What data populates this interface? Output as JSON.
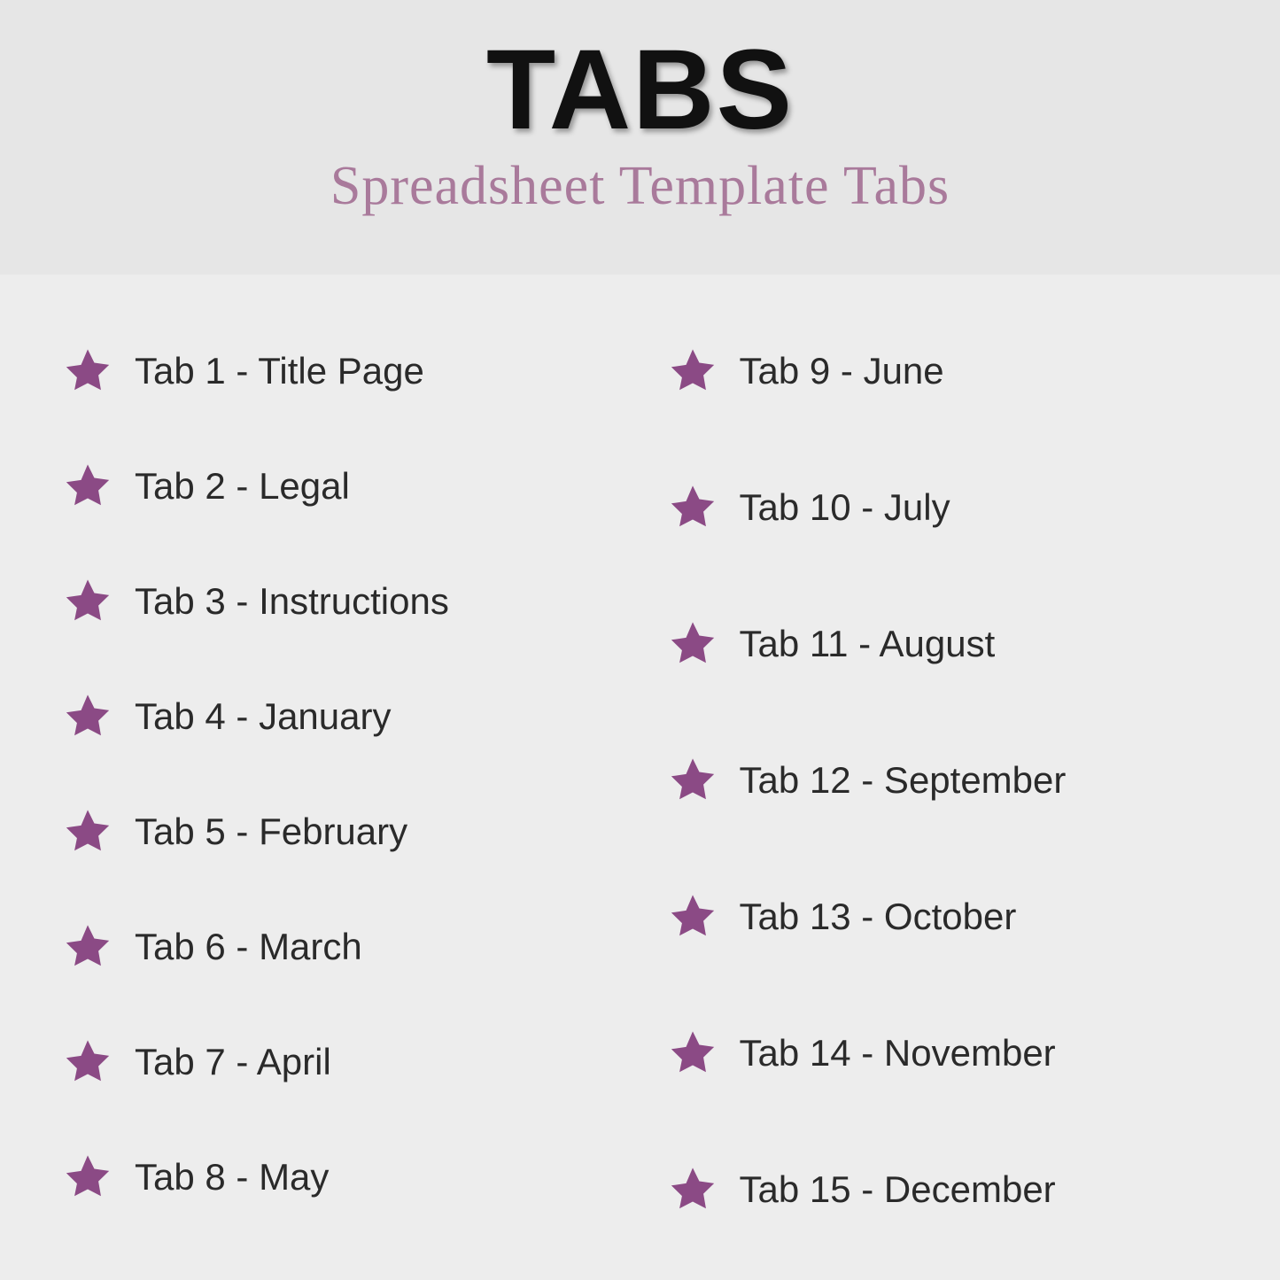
{
  "header": {
    "title": "TABS",
    "subtitle": "Spreadsheet Template Tabs"
  },
  "colors": {
    "star": "#8b4a85"
  },
  "columns": {
    "left": [
      "Tab 1 - Title Page",
      "Tab 2 - Legal",
      "Tab 3 - Instructions",
      "Tab 4 - January",
      "Tab 5 - February",
      "Tab 6 - March",
      "Tab 7 - April",
      "Tab 8 - May"
    ],
    "right": [
      "Tab 9 - June",
      "Tab 10 - July",
      "Tab 11 - August",
      "Tab 12 - September",
      "Tab 13 - October",
      "Tab 14 - November",
      "Tab 15 - December"
    ]
  }
}
